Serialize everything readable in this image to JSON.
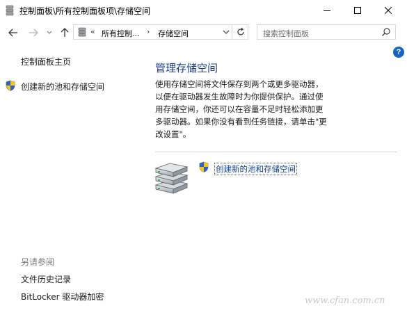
{
  "window": {
    "title": "控制面板\\所有控制面板项\\存储空间"
  },
  "nav": {
    "address_chevrons": "«",
    "address_segment_1": "所有控制...",
    "address_arrow": "›",
    "address_segment_2": "存储空间"
  },
  "search": {
    "placeholder": "搜索控制面板"
  },
  "sidebar": {
    "home_label": "控制面板主页",
    "create_label": "创建新的池和存储空间",
    "see_also_heading": "另请参阅",
    "see_also_items": [
      "文件历史记录",
      "BitLocker 驱动器加密"
    ]
  },
  "main": {
    "title": "管理存储空间",
    "description": "使用存储空间将文件保存到两个或更多驱动器，以便在驱动器发生故障时为你提供保护。通过使用存储空间，你还可以在容量不足时轻松添加更多驱动器。如果你没有看到任务链接，请单击\"更改设置\"。",
    "create_link": "创建新的池和存储空间"
  },
  "watermark": "www.cfan.com.cn",
  "colors": {
    "accent_title": "#1e3d8f",
    "link": "#0b3d91",
    "help_badge": "#1565c0"
  }
}
